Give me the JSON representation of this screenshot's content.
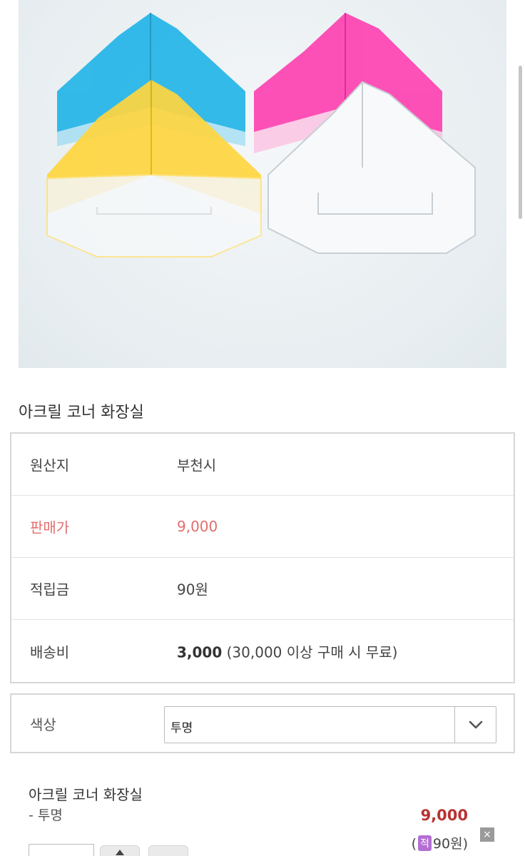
{
  "product": {
    "title": "아크릴 코너 화장실"
  },
  "info": {
    "origin_label": "원산지",
    "origin_value": "부천시",
    "price_label": "판매가",
    "price_value": "9,000",
    "points_label": "적립금",
    "points_value": "90원",
    "shipping_label": "배송비",
    "shipping_value": "3,000",
    "shipping_note": "(30,000 이상 구매 시 무료)"
  },
  "option": {
    "label": "색상",
    "selected": "투명"
  },
  "selection": {
    "name": "아크릴 코너 화장실",
    "option": "- 투명",
    "price": "9,000",
    "points_open": "(",
    "points_badge": "적",
    "points_value": "90원)",
    "remove_icon": "×"
  },
  "colors": {
    "price_red": "#e26e6e",
    "total_red": "#b83232",
    "points_badge": "#b46fd3"
  }
}
